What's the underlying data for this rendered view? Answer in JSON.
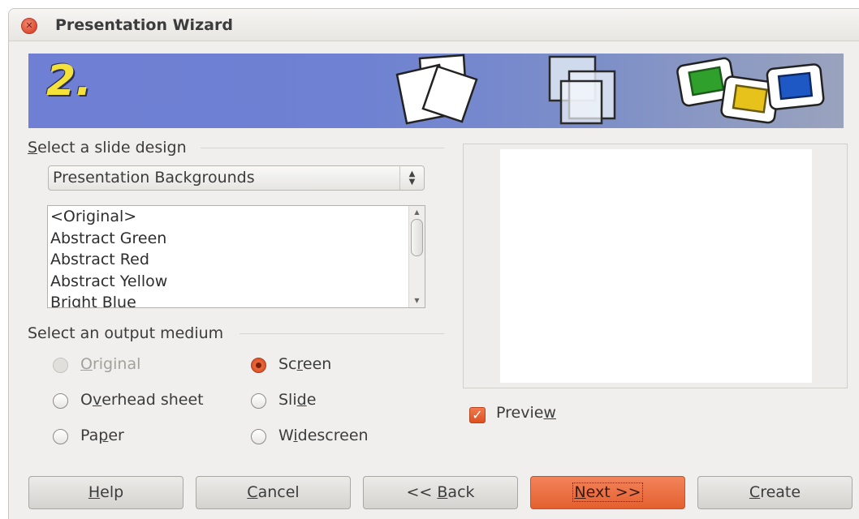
{
  "window": {
    "title": "Presentation Wizard",
    "close_icon": "close-icon"
  },
  "banner": {
    "step": "2."
  },
  "slide_design": {
    "group_label": "Select a slide design",
    "group_label_accel": "S",
    "group_label_rest": "elect a slide design",
    "dropdown_value": "Presentation Backgrounds",
    "items": [
      "<Original>",
      "Abstract Green",
      "Abstract Red",
      "Abstract Yellow",
      "Bright Blue"
    ]
  },
  "output_medium": {
    "group_label": "Select an output medium",
    "options": {
      "original": {
        "pre": "",
        "accel": "O",
        "post": "riginal",
        "state": "disabled"
      },
      "overhead": {
        "pre": "O",
        "accel": "v",
        "post": "erhead sheet",
        "state": "unchecked"
      },
      "paper": {
        "pre": "Pa",
        "accel": "p",
        "post": "er",
        "state": "unchecked"
      },
      "screen": {
        "pre": "Sc",
        "accel": "r",
        "post": "een",
        "state": "checked"
      },
      "slide": {
        "pre": "Sli",
        "accel": "d",
        "post": "e",
        "state": "unchecked"
      },
      "widescreen": {
        "pre": "W",
        "accel": "i",
        "post": "descreen",
        "state": "unchecked"
      }
    }
  },
  "preview": {
    "pre": "Previe",
    "accel": "w",
    "post": "",
    "checked": true
  },
  "buttons": {
    "help": {
      "pre": "",
      "accel": "H",
      "post": "elp"
    },
    "cancel": {
      "pre": "",
      "accel": "C",
      "post": "ancel"
    },
    "back": {
      "pre": "<< ",
      "accel": "B",
      "post": "ack"
    },
    "next": {
      "pre": "",
      "accel": "N",
      "post": "ext >>"
    },
    "create": {
      "pre": "",
      "accel": "C",
      "post": "reate"
    }
  },
  "colors": {
    "accent": "#e4602f",
    "banner": "#6f7fd4",
    "step_number": "#f4e13a"
  }
}
